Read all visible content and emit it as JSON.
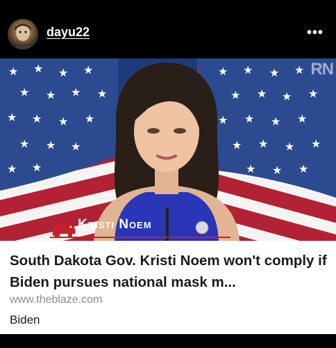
{
  "post": {
    "username": "dayu22",
    "more_icon": "more-horizontal-icon",
    "more_label": "•••"
  },
  "link_preview": {
    "image_watermark": "RN",
    "image_caption": "Kristi Noem",
    "title": "South Dakota Gov. Kristi Noem won't comply if Biden pursues national mask m...",
    "domain": "www.theblaze.com",
    "tag": "Biden"
  }
}
